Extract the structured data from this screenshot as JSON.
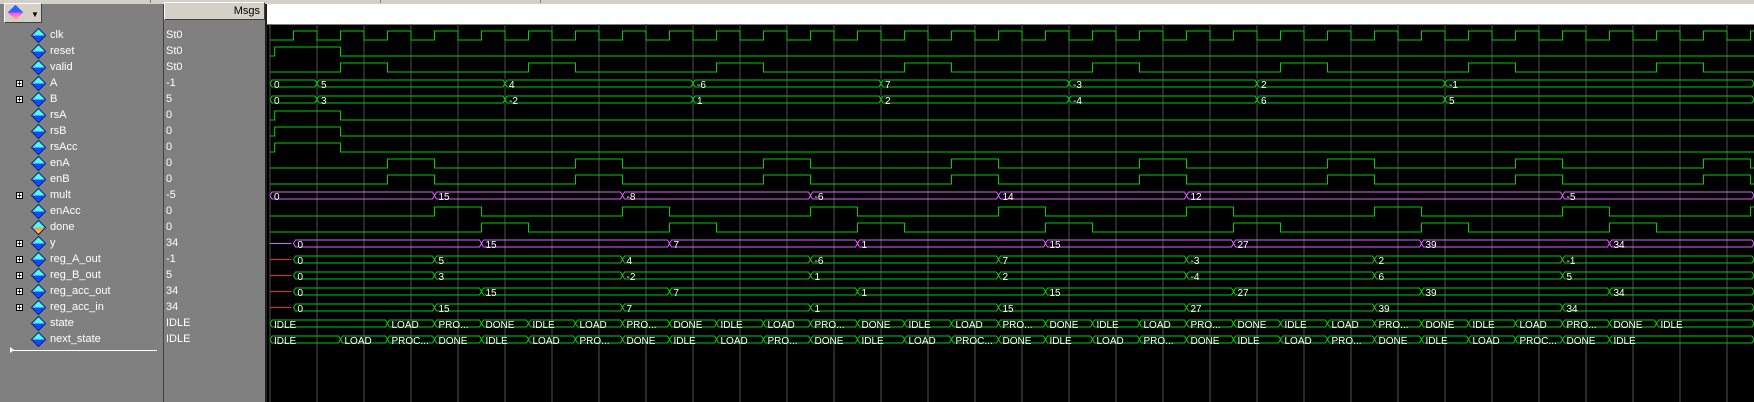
{
  "header": {
    "msgs_label": "Msgs"
  },
  "colors": {
    "logic": "#00d000",
    "vector": "#00d000",
    "analog_vector": "#e060ff",
    "reset_red": "#ff2020",
    "grid": "#505050"
  },
  "signals": [
    {
      "name": "clk",
      "value": "St0",
      "type": "clock",
      "expandable": false
    },
    {
      "name": "reset",
      "value": "St0",
      "type": "bit",
      "expandable": false
    },
    {
      "name": "valid",
      "value": "St0",
      "type": "bit",
      "expandable": false
    },
    {
      "name": "A",
      "value": "-1",
      "type": "bus",
      "expandable": true,
      "segments": [
        {
          "t": 0,
          "v": "0"
        },
        {
          "t": 1,
          "v": "5"
        },
        {
          "t": 5,
          "v": "4"
        },
        {
          "t": 9,
          "v": "-6"
        },
        {
          "t": 13,
          "v": "7"
        },
        {
          "t": 17,
          "v": "-3"
        },
        {
          "t": 21,
          "v": "2"
        },
        {
          "t": 25,
          "v": "-1"
        }
      ]
    },
    {
      "name": "B",
      "value": "5",
      "type": "bus",
      "expandable": true,
      "segments": [
        {
          "t": 0,
          "v": "0"
        },
        {
          "t": 1,
          "v": "3"
        },
        {
          "t": 5,
          "v": "-2"
        },
        {
          "t": 9,
          "v": "1"
        },
        {
          "t": 13,
          "v": "2"
        },
        {
          "t": 17,
          "v": "-4"
        },
        {
          "t": 21,
          "v": "6"
        },
        {
          "t": 25,
          "v": "5"
        }
      ]
    },
    {
      "name": "rsA",
      "value": "0",
      "type": "bit",
      "expandable": false
    },
    {
      "name": "rsB",
      "value": "0",
      "type": "bit",
      "expandable": false
    },
    {
      "name": "rsAcc",
      "value": "0",
      "type": "bit",
      "expandable": false
    },
    {
      "name": "enA",
      "value": "0",
      "type": "bit",
      "expandable": false
    },
    {
      "name": "enB",
      "value": "0",
      "type": "bit",
      "expandable": false
    },
    {
      "name": "mult",
      "value": "-5",
      "type": "bus_pink",
      "expandable": true,
      "segments": [
        {
          "t": 0,
          "v": "0"
        },
        {
          "t": 3.5,
          "v": "15"
        },
        {
          "t": 7.5,
          "v": "-8"
        },
        {
          "t": 11.5,
          "v": "-6"
        },
        {
          "t": 15.5,
          "v": "14"
        },
        {
          "t": 19.5,
          "v": "12"
        },
        {
          "t": 27.5,
          "v": "-5"
        }
      ]
    },
    {
      "name": "enAcc",
      "value": "0",
      "type": "bit",
      "expandable": false
    },
    {
      "name": "done",
      "value": "0",
      "type": "bit",
      "expandable": false,
      "icon": "out"
    },
    {
      "name": "y",
      "value": "34",
      "type": "bus_pink",
      "expandable": true,
      "segments": [
        {
          "t": 0.5,
          "v": "0"
        },
        {
          "t": 4.5,
          "v": "15"
        },
        {
          "t": 8.5,
          "v": "7"
        },
        {
          "t": 12.5,
          "v": "1"
        },
        {
          "t": 16.5,
          "v": "15"
        },
        {
          "t": 20.5,
          "v": "27"
        },
        {
          "t": 24.5,
          "v": "39"
        },
        {
          "t": 28.5,
          "v": "34"
        }
      ]
    },
    {
      "name": "reg_A_out",
      "value": "-1",
      "type": "bus",
      "expandable": true,
      "segments": [
        {
          "t": 0.5,
          "v": "0"
        },
        {
          "t": 3.5,
          "v": "5"
        },
        {
          "t": 7.5,
          "v": "4"
        },
        {
          "t": 11.5,
          "v": "-6"
        },
        {
          "t": 15.5,
          "v": "7"
        },
        {
          "t": 19.5,
          "v": "-3"
        },
        {
          "t": 23.5,
          "v": "2"
        },
        {
          "t": 27.5,
          "v": "-1"
        }
      ]
    },
    {
      "name": "reg_B_out",
      "value": "5",
      "type": "bus",
      "expandable": true,
      "segments": [
        {
          "t": 0.5,
          "v": "0"
        },
        {
          "t": 3.5,
          "v": "3"
        },
        {
          "t": 7.5,
          "v": "-2"
        },
        {
          "t": 11.5,
          "v": "1"
        },
        {
          "t": 15.5,
          "v": "2"
        },
        {
          "t": 19.5,
          "v": "-4"
        },
        {
          "t": 23.5,
          "v": "6"
        },
        {
          "t": 27.5,
          "v": "5"
        }
      ]
    },
    {
      "name": "reg_acc_out",
      "value": "34",
      "type": "bus",
      "expandable": true,
      "segments": [
        {
          "t": 0.5,
          "v": "0"
        },
        {
          "t": 4.5,
          "v": "15"
        },
        {
          "t": 8.5,
          "v": "7"
        },
        {
          "t": 12.5,
          "v": "1"
        },
        {
          "t": 16.5,
          "v": "15"
        },
        {
          "t": 20.5,
          "v": "27"
        },
        {
          "t": 24.5,
          "v": "39"
        },
        {
          "t": 28.5,
          "v": "34"
        }
      ]
    },
    {
      "name": "reg_acc_in",
      "value": "34",
      "type": "bus",
      "expandable": true,
      "segments": [
        {
          "t": 0.5,
          "v": "0"
        },
        {
          "t": 3.5,
          "v": "15"
        },
        {
          "t": 7.5,
          "v": "7"
        },
        {
          "t": 11.5,
          "v": "1"
        },
        {
          "t": 15.5,
          "v": "15"
        },
        {
          "t": 19.5,
          "v": "27"
        },
        {
          "t": 23.5,
          "v": "39"
        },
        {
          "t": 27.5,
          "v": "34"
        }
      ]
    },
    {
      "name": "state",
      "value": "IDLE",
      "type": "bus",
      "expandable": false,
      "segments": [
        {
          "t": 0,
          "v": "IDLE"
        },
        {
          "t": 2.5,
          "v": "LOAD"
        },
        {
          "t": 3.5,
          "v": "PRO..."
        },
        {
          "t": 4.5,
          "v": "DONE"
        },
        {
          "t": 5.5,
          "v": "IDLE"
        },
        {
          "t": 6.5,
          "v": "LOAD"
        },
        {
          "t": 7.5,
          "v": "PRO..."
        },
        {
          "t": 8.5,
          "v": "DONE"
        },
        {
          "t": 9.5,
          "v": "IDLE"
        },
        {
          "t": 10.5,
          "v": "LOAD"
        },
        {
          "t": 11.5,
          "v": "PRO..."
        },
        {
          "t": 12.5,
          "v": "DONE"
        },
        {
          "t": 13.5,
          "v": "IDLE"
        },
        {
          "t": 14.5,
          "v": "LOAD"
        },
        {
          "t": 15.5,
          "v": "PRO..."
        },
        {
          "t": 16.5,
          "v": "DONE"
        },
        {
          "t": 17.5,
          "v": "IDLE"
        },
        {
          "t": 18.5,
          "v": "LOAD"
        },
        {
          "t": 19.5,
          "v": "PRO..."
        },
        {
          "t": 20.5,
          "v": "DONE"
        },
        {
          "t": 21.5,
          "v": "IDLE"
        },
        {
          "t": 22.5,
          "v": "LOAD"
        },
        {
          "t": 23.5,
          "v": "PRO..."
        },
        {
          "t": 24.5,
          "v": "DONE"
        },
        {
          "t": 25.5,
          "v": "IDLE"
        },
        {
          "t": 26.5,
          "v": "LOAD"
        },
        {
          "t": 27.5,
          "v": "PRO..."
        },
        {
          "t": 28.5,
          "v": "DONE"
        },
        {
          "t": 29.5,
          "v": "IDLE"
        }
      ]
    },
    {
      "name": "next_state",
      "value": "IDLE",
      "type": "bus",
      "expandable": false,
      "segments": [
        {
          "t": 0,
          "v": "IDLE"
        },
        {
          "t": 1.5,
          "v": "LOAD"
        },
        {
          "t": 2.5,
          "v": "PROC..."
        },
        {
          "t": 3.5,
          "v": "DONE"
        },
        {
          "t": 4.5,
          "v": "IDLE"
        },
        {
          "t": 5.5,
          "v": "LOAD"
        },
        {
          "t": 6.5,
          "v": "PRO..."
        },
        {
          "t": 7.5,
          "v": "DONE"
        },
        {
          "t": 8.5,
          "v": "IDLE"
        },
        {
          "t": 9.5,
          "v": "LOAD"
        },
        {
          "t": 10.5,
          "v": "PRO..."
        },
        {
          "t": 11.5,
          "v": "DONE"
        },
        {
          "t": 12.5,
          "v": "IDLE"
        },
        {
          "t": 13.5,
          "v": "LOAD"
        },
        {
          "t": 14.5,
          "v": "PROC..."
        },
        {
          "t": 15.5,
          "v": "DONE"
        },
        {
          "t": 16.5,
          "v": "IDLE"
        },
        {
          "t": 17.5,
          "v": "LOAD"
        },
        {
          "t": 18.5,
          "v": "PRO..."
        },
        {
          "t": 19.5,
          "v": "DONE"
        },
        {
          "t": 20.5,
          "v": "IDLE"
        },
        {
          "t": 21.5,
          "v": "LOAD"
        },
        {
          "t": 22.5,
          "v": "PRO..."
        },
        {
          "t": 23.5,
          "v": "DONE"
        },
        {
          "t": 24.5,
          "v": "IDLE"
        },
        {
          "t": 25.5,
          "v": "LOAD"
        },
        {
          "t": 26.5,
          "v": "PROC..."
        },
        {
          "t": 27.5,
          "v": "DONE"
        },
        {
          "t": 28.5,
          "v": "IDLE"
        }
      ]
    }
  ]
}
